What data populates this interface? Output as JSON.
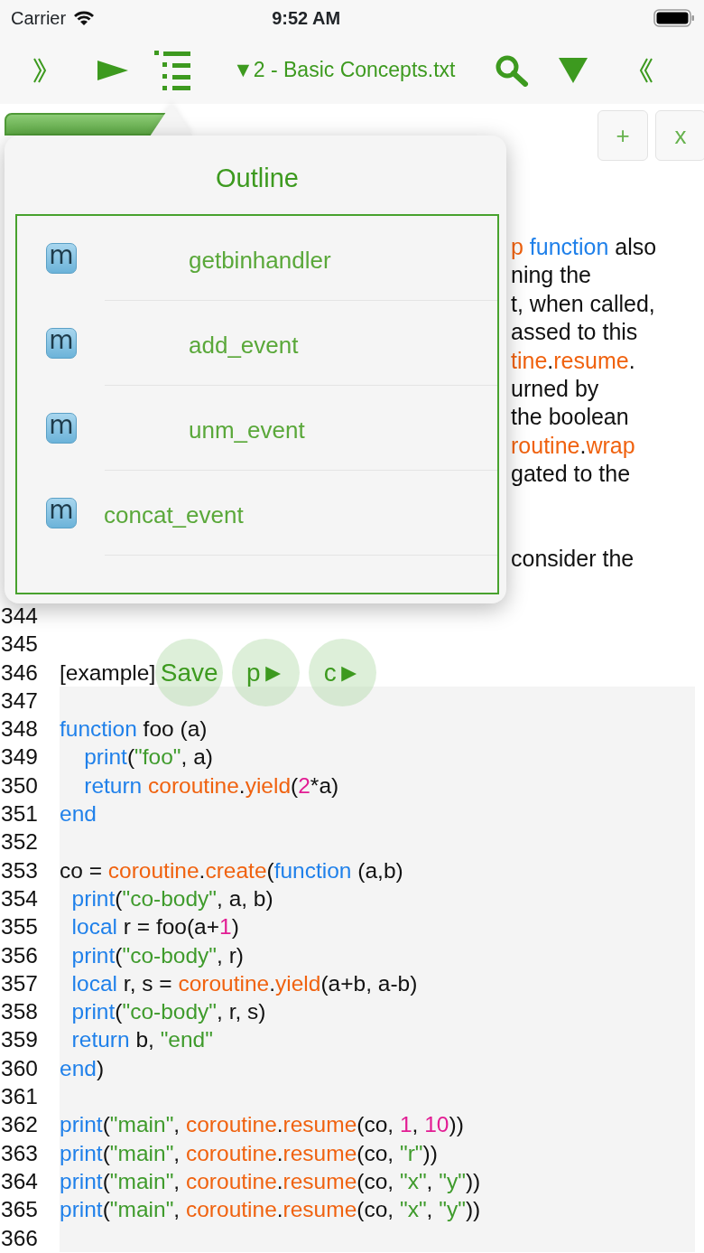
{
  "status_bar": {
    "carrier": "Carrier",
    "time": "9:52 AM"
  },
  "toolbar": {
    "title": "▼2 - Basic Concepts.txt"
  },
  "tab_bar": {
    "tabs": [
      {
        "selected": true
      }
    ],
    "buttons": [
      "+",
      "x"
    ]
  },
  "background_text": [
    {
      "tokens": [
        {
          "t": "p",
          "kind": "function"
        },
        {
          "t": " function",
          "kind": "keyword"
        },
        {
          "t": " also",
          "kind": "plain"
        }
      ]
    },
    {
      "tokens": [
        {
          "t": "ning the",
          "kind": "plain"
        }
      ]
    },
    {
      "tokens": [
        {
          "t": "t, when called,",
          "kind": "plain"
        }
      ]
    },
    {
      "tokens": [
        {
          "t": "assed to this",
          "kind": "plain"
        }
      ]
    },
    {
      "tokens": [
        {
          "t": "tine",
          "kind": "function"
        },
        {
          "t": ".",
          "kind": "plain"
        },
        {
          "t": "resume",
          "kind": "function"
        },
        {
          "t": ".",
          "kind": "plain"
        }
      ]
    },
    {
      "tokens": [
        {
          "t": "urned by",
          "kind": "plain"
        }
      ]
    },
    {
      "tokens": [
        {
          "t": "the boolean",
          "kind": "plain"
        }
      ]
    },
    {
      "tokens": [
        {
          "t": "routine",
          "kind": "function"
        },
        {
          "t": ".",
          "kind": "plain"
        },
        {
          "t": "wrap",
          "kind": "function"
        }
      ]
    },
    {
      "tokens": [
        {
          "t": "gated to the",
          "kind": "plain"
        }
      ]
    },
    {
      "gap_before": true,
      "tokens": [
        {
          "t": "consider the",
          "kind": "plain"
        }
      ]
    }
  ],
  "outline": {
    "title": "Outline",
    "items": [
      {
        "label": "getbinhandler",
        "icon": "m",
        "indented": true
      },
      {
        "label": "add_event",
        "icon": "m",
        "indented": true
      },
      {
        "label": "unm_event",
        "icon": "m",
        "indented": true
      },
      {
        "label": "concat_event",
        "icon": "m",
        "indented": false
      }
    ]
  },
  "code_lines": [
    {
      "number": "344"
    },
    {
      "number": "345"
    },
    {
      "number": "346",
      "tokens": [
        {
          "t": "[example]",
          "kind": "plain"
        }
      ],
      "buttons": [
        "Save",
        "p►",
        "c►"
      ]
    },
    {
      "number": "347",
      "shaded": true
    },
    {
      "number": "348",
      "shaded": true,
      "tokens": [
        {
          "t": "function",
          "kind": "keyword"
        },
        {
          "t": " foo (a)",
          "kind": "plain"
        }
      ]
    },
    {
      "number": "349",
      "shaded": true,
      "tokens": [
        {
          "t": "    print",
          "kind": "keyword"
        },
        {
          "t": "(",
          "kind": "plain"
        },
        {
          "t": "\"foo\"",
          "kind": "string"
        },
        {
          "t": ", a)",
          "kind": "plain"
        }
      ]
    },
    {
      "number": "350",
      "shaded": true,
      "tokens": [
        {
          "t": "    return",
          "kind": "keyword"
        },
        {
          "t": " coroutine",
          "kind": "function"
        },
        {
          "t": ".",
          "kind": "plain"
        },
        {
          "t": "yield",
          "kind": "function"
        },
        {
          "t": "(",
          "kind": "plain"
        },
        {
          "t": "2",
          "kind": "number"
        },
        {
          "t": "*a)",
          "kind": "plain"
        }
      ]
    },
    {
      "number": "351",
      "shaded": true,
      "tokens": [
        {
          "t": "end",
          "kind": "keyword"
        }
      ]
    },
    {
      "number": "352",
      "shaded": true
    },
    {
      "number": "353",
      "shaded": true,
      "tokens": [
        {
          "t": "co = ",
          "kind": "plain"
        },
        {
          "t": "coroutine",
          "kind": "function"
        },
        {
          "t": ".",
          "kind": "plain"
        },
        {
          "t": "create",
          "kind": "function"
        },
        {
          "t": "(",
          "kind": "plain"
        },
        {
          "t": "function",
          "kind": "keyword"
        },
        {
          "t": " (a,b)",
          "kind": "plain"
        }
      ]
    },
    {
      "number": "354",
      "shaded": true,
      "tokens": [
        {
          "t": "  print",
          "kind": "keyword"
        },
        {
          "t": "(",
          "kind": "plain"
        },
        {
          "t": "\"co-body\"",
          "kind": "string"
        },
        {
          "t": ", a, b)",
          "kind": "plain"
        }
      ]
    },
    {
      "number": "355",
      "shaded": true,
      "tokens": [
        {
          "t": "  local",
          "kind": "keyword"
        },
        {
          "t": " r = foo(a+",
          "kind": "plain"
        },
        {
          "t": "1",
          "kind": "number"
        },
        {
          "t": ")",
          "kind": "plain"
        }
      ]
    },
    {
      "number": "356",
      "shaded": true,
      "tokens": [
        {
          "t": "  print",
          "kind": "keyword"
        },
        {
          "t": "(",
          "kind": "plain"
        },
        {
          "t": "\"co-body\"",
          "kind": "string"
        },
        {
          "t": ", r)",
          "kind": "plain"
        }
      ]
    },
    {
      "number": "357",
      "shaded": true,
      "tokens": [
        {
          "t": "  local",
          "kind": "keyword"
        },
        {
          "t": " r, s = ",
          "kind": "plain"
        },
        {
          "t": "coroutine",
          "kind": "function"
        },
        {
          "t": ".",
          "kind": "plain"
        },
        {
          "t": "yield",
          "kind": "function"
        },
        {
          "t": "(a+b, a-b)",
          "kind": "plain"
        }
      ]
    },
    {
      "number": "358",
      "shaded": true,
      "tokens": [
        {
          "t": "  print",
          "kind": "keyword"
        },
        {
          "t": "(",
          "kind": "plain"
        },
        {
          "t": "\"co-body\"",
          "kind": "string"
        },
        {
          "t": ", r, s)",
          "kind": "plain"
        }
      ]
    },
    {
      "number": "359",
      "shaded": true,
      "tokens": [
        {
          "t": "  return",
          "kind": "keyword"
        },
        {
          "t": " b, ",
          "kind": "plain"
        },
        {
          "t": "\"end\"",
          "kind": "string"
        }
      ]
    },
    {
      "number": "360",
      "shaded": true,
      "tokens": [
        {
          "t": "end",
          "kind": "keyword"
        },
        {
          "t": ")",
          "kind": "plain"
        }
      ]
    },
    {
      "number": "361",
      "shaded": true
    },
    {
      "number": "362",
      "shaded": true,
      "tokens": [
        {
          "t": "print",
          "kind": "keyword"
        },
        {
          "t": "(",
          "kind": "plain"
        },
        {
          "t": "\"main\"",
          "kind": "string"
        },
        {
          "t": ", ",
          "kind": "plain"
        },
        {
          "t": "coroutine",
          "kind": "function"
        },
        {
          "t": ".",
          "kind": "plain"
        },
        {
          "t": "resume",
          "kind": "function"
        },
        {
          "t": "(co, ",
          "kind": "plain"
        },
        {
          "t": "1",
          "kind": "number"
        },
        {
          "t": ", ",
          "kind": "plain"
        },
        {
          "t": "10",
          "kind": "number"
        },
        {
          "t": "))",
          "kind": "plain"
        }
      ]
    },
    {
      "number": "363",
      "shaded": true,
      "tokens": [
        {
          "t": "print",
          "kind": "keyword"
        },
        {
          "t": "(",
          "kind": "plain"
        },
        {
          "t": "\"main\"",
          "kind": "string"
        },
        {
          "t": ", ",
          "kind": "plain"
        },
        {
          "t": "coroutine",
          "kind": "function"
        },
        {
          "t": ".",
          "kind": "plain"
        },
        {
          "t": "resume",
          "kind": "function"
        },
        {
          "t": "(co, ",
          "kind": "plain"
        },
        {
          "t": "\"r\"",
          "kind": "string"
        },
        {
          "t": "))",
          "kind": "plain"
        }
      ]
    },
    {
      "number": "364",
      "shaded": true,
      "tokens": [
        {
          "t": "print",
          "kind": "keyword"
        },
        {
          "t": "(",
          "kind": "plain"
        },
        {
          "t": "\"main\"",
          "kind": "string"
        },
        {
          "t": ", ",
          "kind": "plain"
        },
        {
          "t": "coroutine",
          "kind": "function"
        },
        {
          "t": ".",
          "kind": "plain"
        },
        {
          "t": "resume",
          "kind": "function"
        },
        {
          "t": "(co, ",
          "kind": "plain"
        },
        {
          "t": "\"x\"",
          "kind": "string"
        },
        {
          "t": ", ",
          "kind": "plain"
        },
        {
          "t": "\"y\"",
          "kind": "string"
        },
        {
          "t": "))",
          "kind": "plain"
        }
      ]
    },
    {
      "number": "365",
      "shaded": true,
      "tokens": [
        {
          "t": "print",
          "kind": "keyword"
        },
        {
          "t": "(",
          "kind": "plain"
        },
        {
          "t": "\"main\"",
          "kind": "string"
        },
        {
          "t": ", ",
          "kind": "plain"
        },
        {
          "t": "coroutine",
          "kind": "function"
        },
        {
          "t": ".",
          "kind": "plain"
        },
        {
          "t": "resume",
          "kind": "function"
        },
        {
          "t": "(co, ",
          "kind": "plain"
        },
        {
          "t": "\"x\"",
          "kind": "string"
        },
        {
          "t": ", ",
          "kind": "plain"
        },
        {
          "t": "\"y\"",
          "kind": "string"
        },
        {
          "t": "))",
          "kind": "plain"
        }
      ]
    },
    {
      "number": "366",
      "shaded": true
    }
  ]
}
